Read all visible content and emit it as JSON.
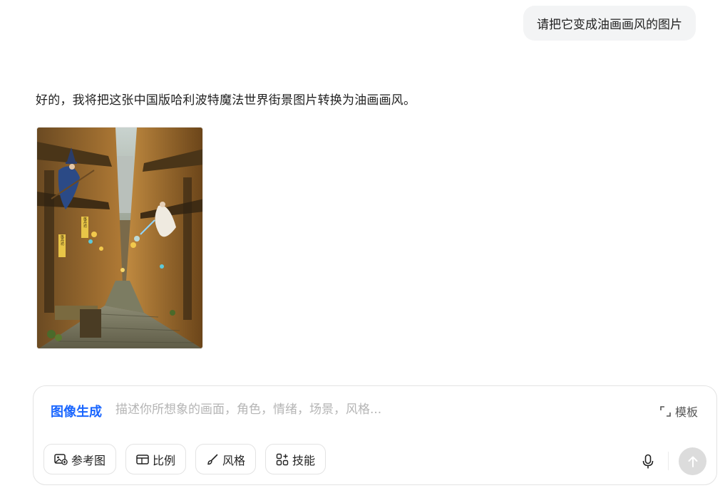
{
  "chat": {
    "user_message": "请把它变成油画画风的图片",
    "assistant_message": "好的，我将把这张中国版哈利波特魔法世界街景图片转换为油画画风。"
  },
  "composer": {
    "mode_label": "图像生成",
    "placeholder": "描述你所想象的画面，角色，情绪，场景，风格...",
    "value": "",
    "template_label": "模板",
    "tools": [
      {
        "label": "参考图",
        "icon": "image-plus-icon"
      },
      {
        "label": "比例",
        "icon": "aspect-ratio-icon"
      },
      {
        "label": "风格",
        "icon": "brush-icon"
      },
      {
        "label": "技能",
        "icon": "apps-plus-icon"
      }
    ],
    "mic_icon": "microphone-icon",
    "send_icon": "arrow-up-icon"
  },
  "image_signs": [
    "炼丹坊",
    "炼丹坊"
  ],
  "colors": {
    "accent": "#1a66ff",
    "bubble_bg": "#f3f4f5",
    "send_disabled": "#dcdcdc"
  }
}
